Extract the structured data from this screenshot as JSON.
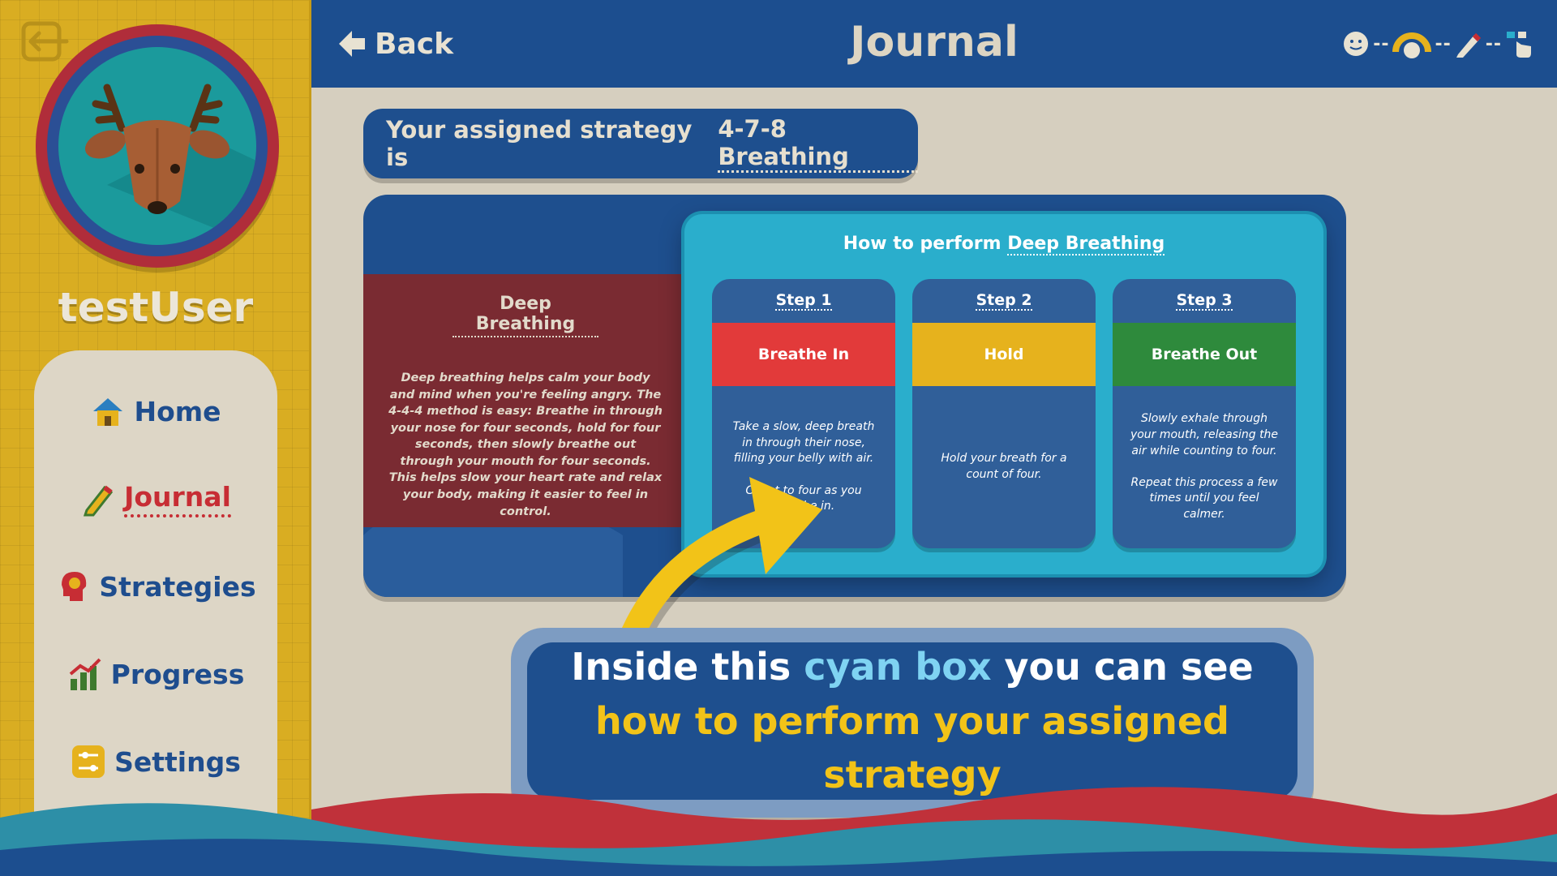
{
  "sidebar": {
    "username": "testUser",
    "nav": [
      {
        "label": "Home",
        "icon": "home-icon"
      },
      {
        "label": "Journal",
        "icon": "pencil-icon",
        "active": true
      },
      {
        "label": "Strategies",
        "icon": "head-icon"
      },
      {
        "label": "Progress",
        "icon": "chart-icon"
      },
      {
        "label": "Settings",
        "icon": "sliders-icon"
      }
    ]
  },
  "header": {
    "back_label": "Back",
    "title": "Journal",
    "progress_icons": [
      "smiley-icon",
      "face-meter-icon",
      "pencil-icon",
      "pointer-icon"
    ]
  },
  "strategy": {
    "prefix": "Your assigned strategy is",
    "name": "4-7-8 Breathing"
  },
  "description": {
    "title": "Deep Breathing",
    "body": "Deep breathing helps calm your body and mind when you're feeling angry. The 4-4-4 method is easy: Breathe in through your nose for four seconds, hold for four seconds, then slowly breathe out through your mouth for four seconds. This helps slow your heart rate and relax your body, making it easier to feel in control."
  },
  "howto": {
    "prefix": "How to perform",
    "name": "Deep Breathing",
    "steps": [
      {
        "step": "Step 1",
        "action": "Breathe In",
        "color": "#e23a3a",
        "text": "Take a slow, deep breath in through their nose, filling your belly with air.\n\nCount to four as you breathe in."
      },
      {
        "step": "Step 2",
        "action": "Hold",
        "color": "#e6b21d",
        "text": "Hold your breath for a count of four."
      },
      {
        "step": "Step 3",
        "action": "Breathe Out",
        "color": "#2e8a3c",
        "text": "Slowly exhale through your mouth, releasing the air while counting to four.\n\nRepeat this process a few times until you feel calmer."
      }
    ]
  },
  "tip": {
    "part1": "Inside this ",
    "part2": "cyan box",
    "part3": " you can see ",
    "part4": "how to perform your assigned strategy"
  },
  "colors": {
    "navy": "#1e4f8e",
    "cyan": "#2aaecc",
    "sidebar_yellow": "#d9ad22",
    "accent_red": "#c72d34",
    "highlight_cyan": "#7fd3f2",
    "highlight_yellow": "#f2c318"
  }
}
